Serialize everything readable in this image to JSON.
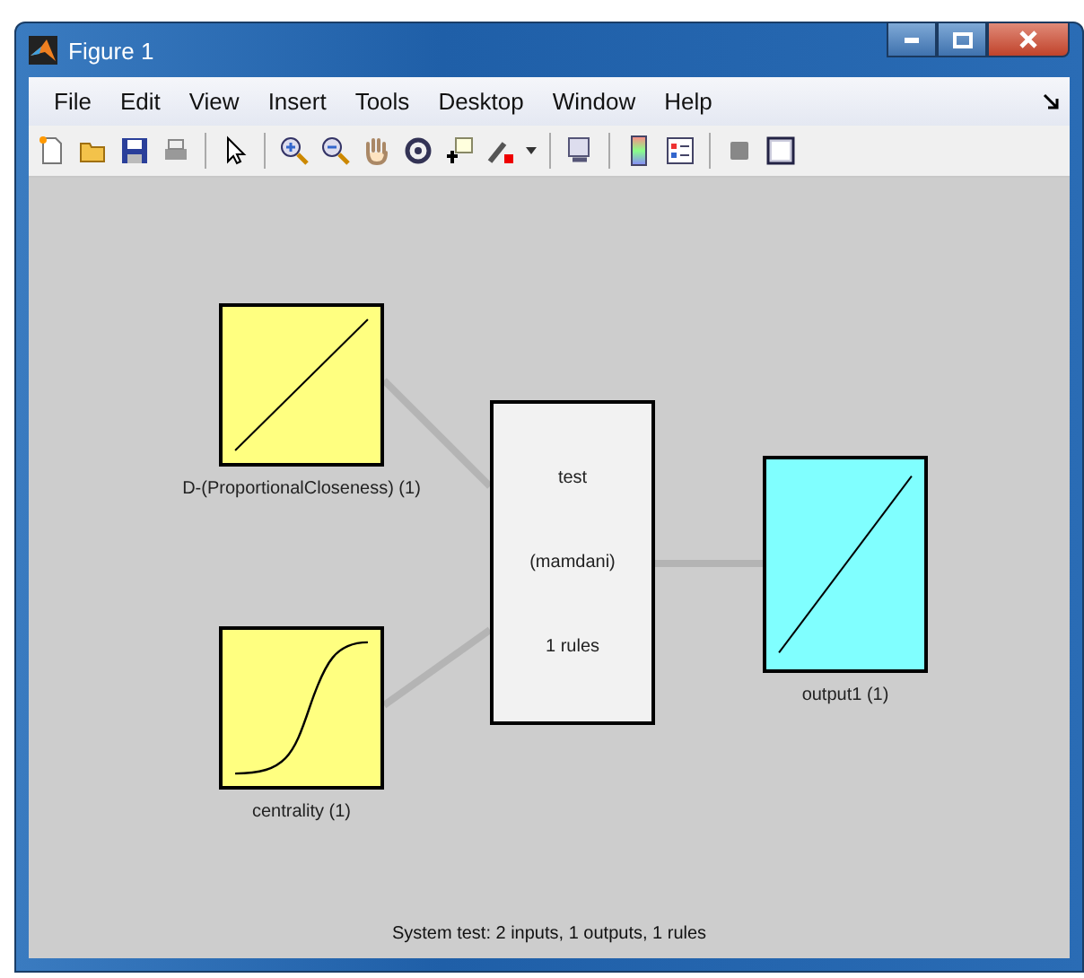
{
  "window": {
    "title": "Figure 1"
  },
  "menu": [
    "File",
    "Edit",
    "View",
    "Insert",
    "Tools",
    "Desktop",
    "Window",
    "Help"
  ],
  "inputs": [
    {
      "label": "D-(ProportionalCloseness) (1)",
      "kind": "linear"
    },
    {
      "label": "centrality (1)",
      "kind": "sigmoid"
    }
  ],
  "system": {
    "name": "test",
    "type": "(mamdani)",
    "rules": "1 rules"
  },
  "outputs": [
    {
      "label": "output1 (1)",
      "kind": "linear"
    }
  ],
  "status_bar": "System test: 2 inputs, 1 outputs, 1 rules"
}
